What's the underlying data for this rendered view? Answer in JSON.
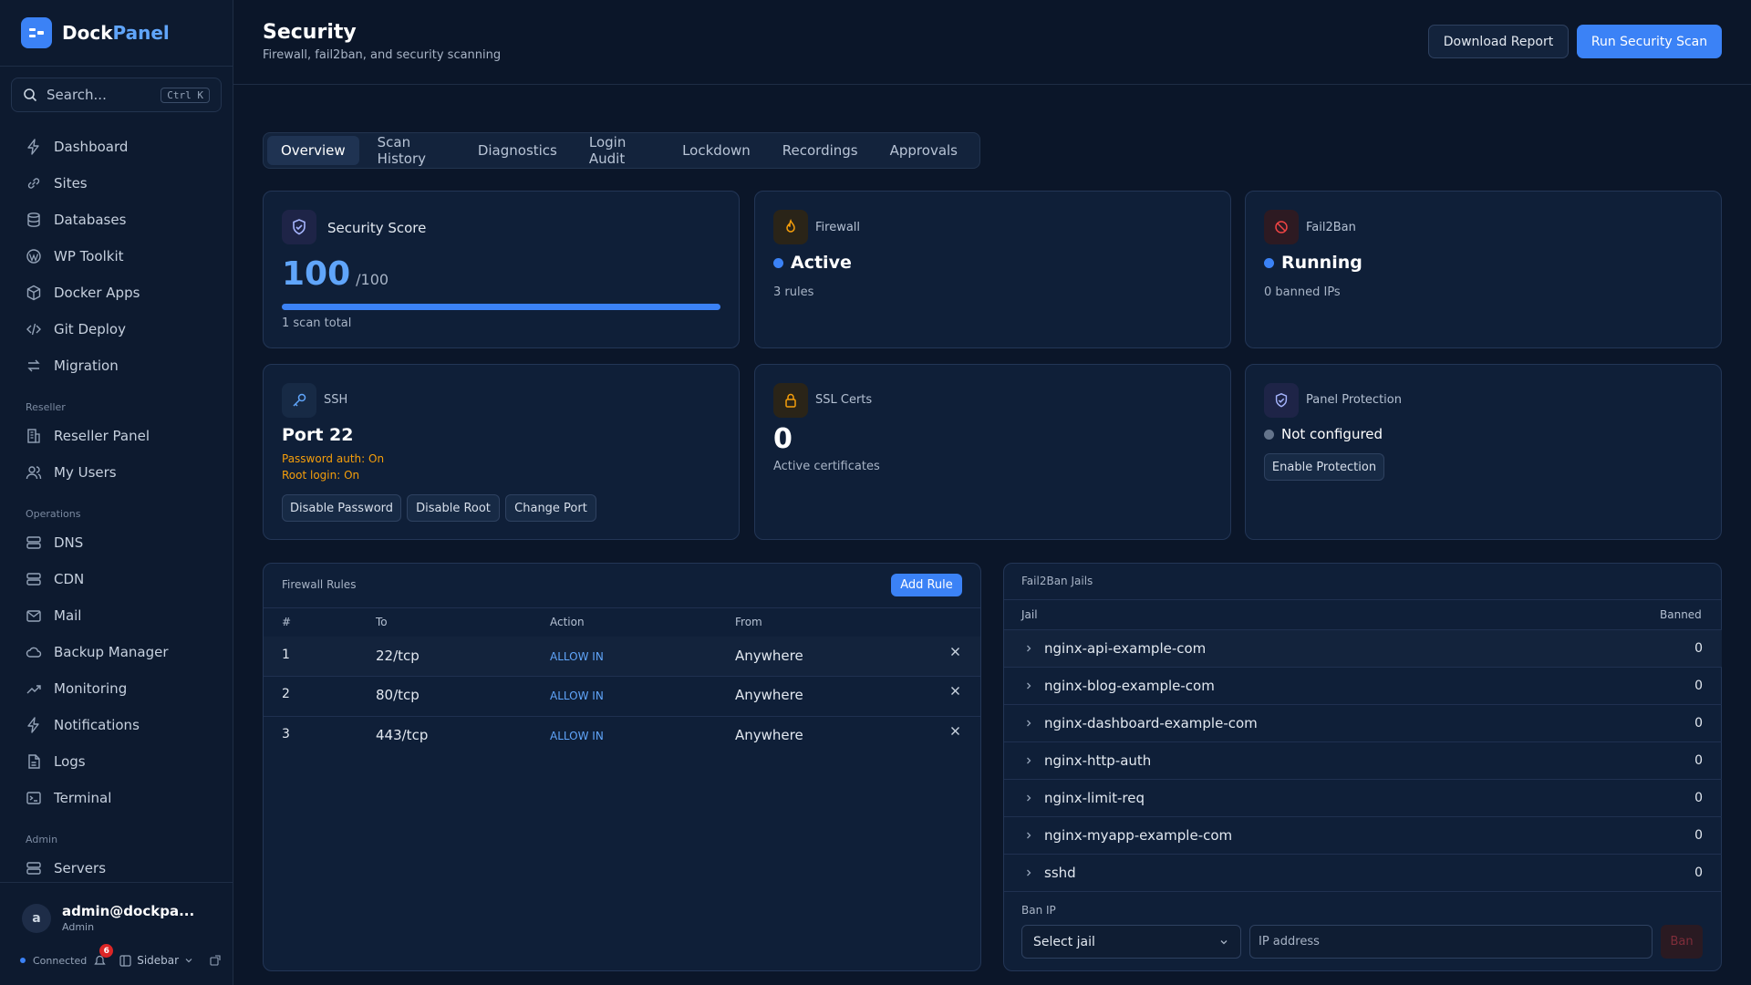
{
  "app": {
    "brand_first": "Dock",
    "brand_second": "Panel"
  },
  "search": {
    "placeholder": "Search...",
    "shortcut": "Ctrl K"
  },
  "sidebar": {
    "main_items": [
      {
        "label": "Dashboard",
        "icon": "lightning-icon"
      },
      {
        "label": "Sites",
        "icon": "link-icon"
      },
      {
        "label": "Databases",
        "icon": "database-icon"
      },
      {
        "label": "WP Toolkit",
        "icon": "wordpress-icon"
      },
      {
        "label": "Docker Apps",
        "icon": "box-icon"
      },
      {
        "label": "Git Deploy",
        "icon": "code-icon"
      },
      {
        "label": "Migration",
        "icon": "arrows-icon"
      }
    ],
    "reseller_title": "Reseller",
    "reseller_items": [
      {
        "label": "Reseller Panel",
        "icon": "building-icon"
      },
      {
        "label": "My Users",
        "icon": "users-icon"
      }
    ],
    "operations_title": "Operations",
    "operations_items": [
      {
        "label": "DNS",
        "icon": "server-icon"
      },
      {
        "label": "CDN",
        "icon": "server-icon"
      },
      {
        "label": "Mail",
        "icon": "mail-icon"
      },
      {
        "label": "Backup Manager",
        "icon": "cloud-icon"
      },
      {
        "label": "Monitoring",
        "icon": "trend-icon"
      },
      {
        "label": "Notifications",
        "icon": "lightning-icon"
      },
      {
        "label": "Logs",
        "icon": "file-icon"
      },
      {
        "label": "Terminal",
        "icon": "terminal-icon"
      }
    ],
    "admin_title": "Admin",
    "admin_items": [
      {
        "label": "Servers",
        "icon": "server-icon"
      }
    ]
  },
  "user": {
    "email": "admin@dockpa...",
    "role": "Admin",
    "initial": "a"
  },
  "status_bar": {
    "connection": "Connected",
    "notification_count": "6",
    "sidebar_label": "Sidebar"
  },
  "header": {
    "title": "Security",
    "subtitle": "Firewall, fail2ban, and security scanning",
    "download_label": "Download Report",
    "scan_label": "Run Security Scan"
  },
  "tabs": [
    "Overview",
    "Scan History",
    "Diagnostics",
    "Login Audit",
    "Lockdown",
    "Recordings",
    "Approvals"
  ],
  "active_tab": "Overview",
  "cards": {
    "score": {
      "label": "Security Score",
      "value": "100",
      "max": "/100",
      "progress": 1.0,
      "note": "1 scan total"
    },
    "firewall": {
      "label": "Firewall",
      "status": "Active",
      "note": "3 rules"
    },
    "fail2ban": {
      "label": "Fail2Ban",
      "status": "Running",
      "note": "0 banned IPs"
    },
    "ssh": {
      "label": "SSH",
      "port": "Port 22",
      "password_auth": "Password auth: On",
      "root_login": "Root login: On",
      "btn_disable_password": "Disable Password",
      "btn_disable_root": "Disable Root",
      "btn_change_port": "Change Port"
    },
    "ssl": {
      "label": "SSL Certs",
      "value": "0",
      "note": "Active certificates"
    },
    "panel": {
      "label": "Panel Protection",
      "status": "Not configured",
      "btn_enable": "Enable Protection"
    }
  },
  "firewall_rules": {
    "title": "Firewall Rules",
    "add_label": "Add Rule",
    "headers": [
      "#",
      "To",
      "Action",
      "From"
    ],
    "rows": [
      {
        "num": "1",
        "to": "22/tcp",
        "action": "ALLOW IN",
        "from": "Anywhere"
      },
      {
        "num": "2",
        "to": "80/tcp",
        "action": "ALLOW IN",
        "from": "Anywhere"
      },
      {
        "num": "3",
        "to": "443/tcp",
        "action": "ALLOW IN",
        "from": "Anywhere"
      }
    ]
  },
  "jails": {
    "title": "Fail2Ban Jails",
    "col_jail": "Jail",
    "col_banned": "Banned",
    "rows": [
      {
        "name": "nginx-api-example-com",
        "banned": "0"
      },
      {
        "name": "nginx-blog-example-com",
        "banned": "0"
      },
      {
        "name": "nginx-dashboard-example-com",
        "banned": "0"
      },
      {
        "name": "nginx-http-auth",
        "banned": "0"
      },
      {
        "name": "nginx-limit-req",
        "banned": "0"
      },
      {
        "name": "nginx-myapp-example-com",
        "banned": "0"
      },
      {
        "name": "sshd",
        "banned": "0"
      }
    ],
    "ban_title": "Ban IP",
    "select_value": "Select jail",
    "ip_placeholder": "IP address",
    "ban_label": "Ban"
  },
  "colors": {
    "accent": "#3b82f6",
    "warning": "#f59e0b",
    "danger": "#ef4444",
    "muted_dot": "#64748b"
  }
}
